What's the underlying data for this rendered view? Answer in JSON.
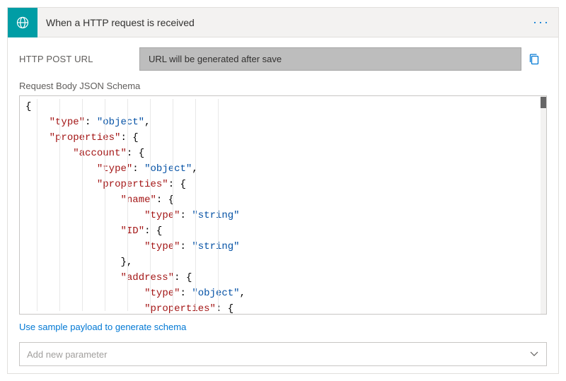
{
  "header": {
    "title": "When a HTTP request is received",
    "more_label": "···"
  },
  "url_section": {
    "label": "HTTP POST URL",
    "placeholder_text": "URL will be generated after save"
  },
  "schema_section": {
    "label": "Request Body JSON Schema",
    "raw": "{\n    \"type\": \"object\",\n    \"properties\": {\n        \"account\": {\n            \"type\": \"object\",\n            \"properties\": {\n                \"name\": {\n                    \"type\": \"string\"\n                \"ID\": {\n                    \"type\": \"string\"\n                },\n                \"address\": {\n                    \"type\": \"object\",\n                    \"properties\": {\n                        \"number\": {\n                            \"type\": \"string\""
  },
  "sample_link": "Use sample payload to generate schema",
  "add_parameter": {
    "placeholder": "Add new parameter"
  },
  "icons": {
    "http": "http-globe-icon",
    "copy": "copy-icon",
    "chevron": "chevron-down-icon"
  }
}
